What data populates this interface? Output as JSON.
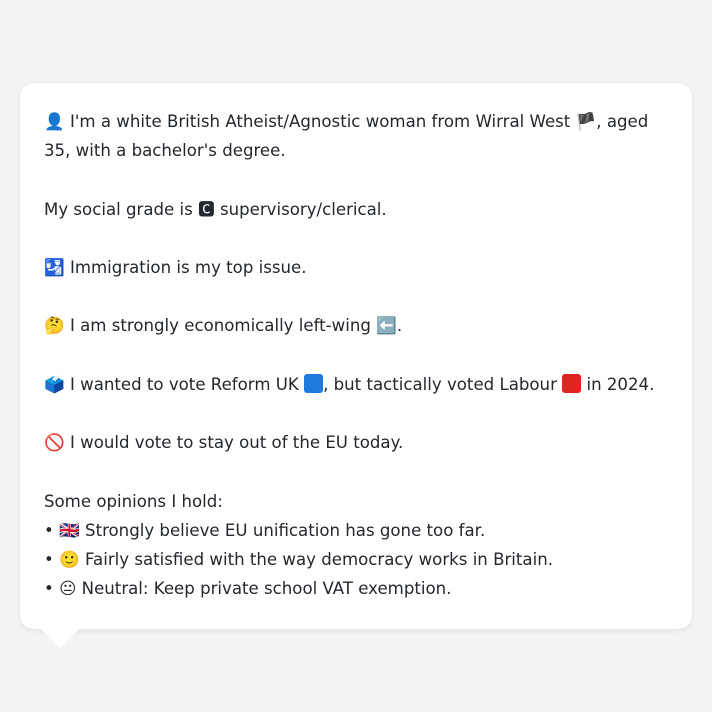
{
  "profile": {
    "intro_icon": "👤",
    "intro_text_a": "I'm a white British Atheist/Agnostic woman from Wirral West",
    "intro_flag": "🏴",
    "intro_text_b": ", aged",
    "intro_text_c": "35, with a bachelor's degree.",
    "grade_text_a": "My social grade is",
    "grade_icon": "🅲",
    "grade_text_b": "supervisory/clerical.",
    "issue_icon": "🛂",
    "issue_text": "Immigration is my top issue.",
    "econ_icon": "🤔",
    "econ_text": "I am strongly economically left-wing",
    "econ_arrow": "⬅️",
    "econ_end": ".",
    "vote_icon": "🗳️",
    "vote_text_a": "I wanted to vote Reform UK",
    "vote_text_b": ", but tactically voted Labour",
    "vote_text_c": "in 2024.",
    "reform_color": "#1f7ae0",
    "labour_color": "#e0241f",
    "eu_icon": "🚫",
    "eu_text": "I would vote to stay out of the EU today.",
    "opinions_header": "Some opinions I hold:",
    "opinions": [
      {
        "bullet": "•",
        "icon": "🇬🇧",
        "text": "Strongly believe EU unification has gone too far."
      },
      {
        "bullet": "•",
        "icon": "🙂",
        "text": "Fairly satisfied with the way democracy works in Britain."
      },
      {
        "bullet": "•",
        "icon": "😐",
        "text": "Neutral: Keep private school VAT exemption."
      }
    ]
  }
}
